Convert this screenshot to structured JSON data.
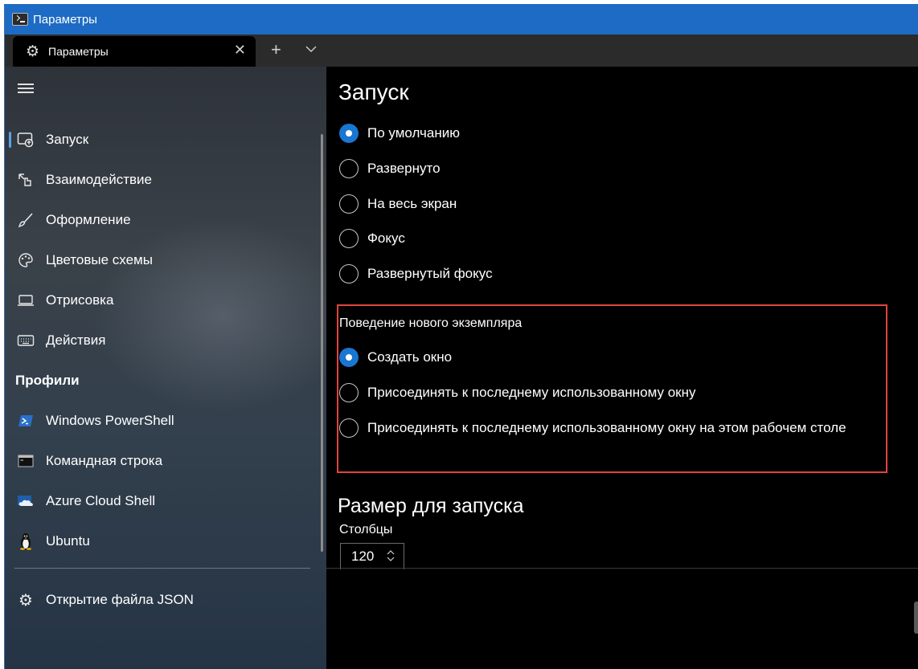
{
  "window": {
    "title": "Параметры",
    "tab_label": "Параметры"
  },
  "sidebar": {
    "items": [
      {
        "label": "Запуск",
        "icon": "launch-icon",
        "active": true
      },
      {
        "label": "Взаимодействие",
        "icon": "interaction-icon"
      },
      {
        "label": "Оформление",
        "icon": "brush-icon"
      },
      {
        "label": "Цветовые схемы",
        "icon": "palette-icon"
      },
      {
        "label": "Отрисовка",
        "icon": "laptop-icon"
      },
      {
        "label": "Действия",
        "icon": "keyboard-icon"
      }
    ],
    "profiles_header": "Профили",
    "profiles": [
      {
        "label": "Windows PowerShell",
        "icon": "powershell-icon"
      },
      {
        "label": "Командная строка",
        "icon": "cmd-icon"
      },
      {
        "label": "Azure Cloud Shell",
        "icon": "azure-cloud-icon"
      },
      {
        "label": "Ubuntu",
        "icon": "linux-penguin-icon"
      }
    ],
    "open_json": {
      "label": "Открытие файла JSON",
      "icon": "gear-icon"
    }
  },
  "main": {
    "title": "Запуск",
    "launch_mode_options": [
      {
        "label": "По умолчанию",
        "checked": true
      },
      {
        "label": "Развернуто",
        "checked": false
      },
      {
        "label": "На весь экран",
        "checked": false
      },
      {
        "label": "Фокус",
        "checked": false
      },
      {
        "label": "Развернутый фокус",
        "checked": false
      }
    ],
    "new_instance": {
      "label": "Поведение нового экземпляра",
      "options": [
        {
          "label": "Создать окно",
          "checked": true
        },
        {
          "label": "Присоединять к последнему использованному окну",
          "checked": false
        },
        {
          "label": "Присоединять к последнему использованному окну на этом рабочем столе",
          "checked": false
        }
      ]
    },
    "launch_size": {
      "title": "Размер для запуска",
      "columns_label": "Столбцы",
      "columns_value": "120"
    }
  },
  "colors": {
    "accent": "#1976d2",
    "titlebar": "#1d6bc4",
    "highlight": "#e0443e"
  }
}
